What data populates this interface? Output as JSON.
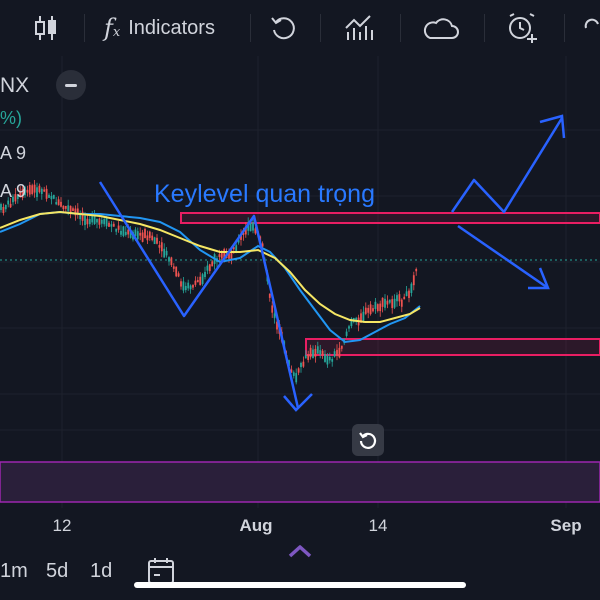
{
  "toolbar": {
    "indicators_label": "Indicators",
    "fx_label": "f",
    "fx_sub": "x"
  },
  "legend": {
    "symbol": "NX",
    "change": "%)",
    "ma1": "A 9",
    "ma2": "A 9"
  },
  "annotation": {
    "text": "Keylevel quan trọng"
  },
  "xaxis": {
    "labels": [
      "12",
      "Aug",
      "14",
      "Sep"
    ]
  },
  "intervals": [
    "1m",
    "5d",
    "1d"
  ],
  "colors": {
    "background": "#131722",
    "drawing": "#2962ff",
    "zone": "#e91e63",
    "ma_yellow": "#f5e664",
    "ma_blue": "#2196f3",
    "up": "#26a69a",
    "down": "#ef5350"
  }
}
